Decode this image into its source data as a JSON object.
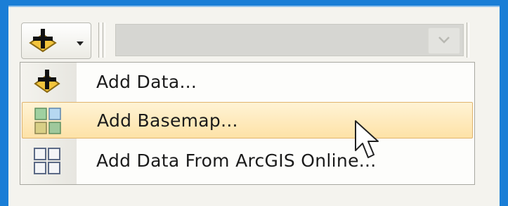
{
  "toolbar": {
    "add_button_icon": "add-data-icon",
    "dropdown_icon": "chevron-down-icon",
    "combo_value": ""
  },
  "menu": {
    "items": [
      {
        "label": "Add Data...",
        "icon": "add-data-icon"
      },
      {
        "label": "Add Basemap...",
        "icon": "basemap-icon",
        "highlighted": true
      },
      {
        "label": "Add Data From ArcGIS Online...",
        "icon": "arcgis-online-grid-icon"
      }
    ]
  },
  "colors": {
    "window_border": "#1a7ed6",
    "highlight_top": "#fff3d5",
    "highlight_bottom": "#fde2a7",
    "highlight_border": "#e0b46e",
    "plus_yellow": "#f3c43c"
  }
}
